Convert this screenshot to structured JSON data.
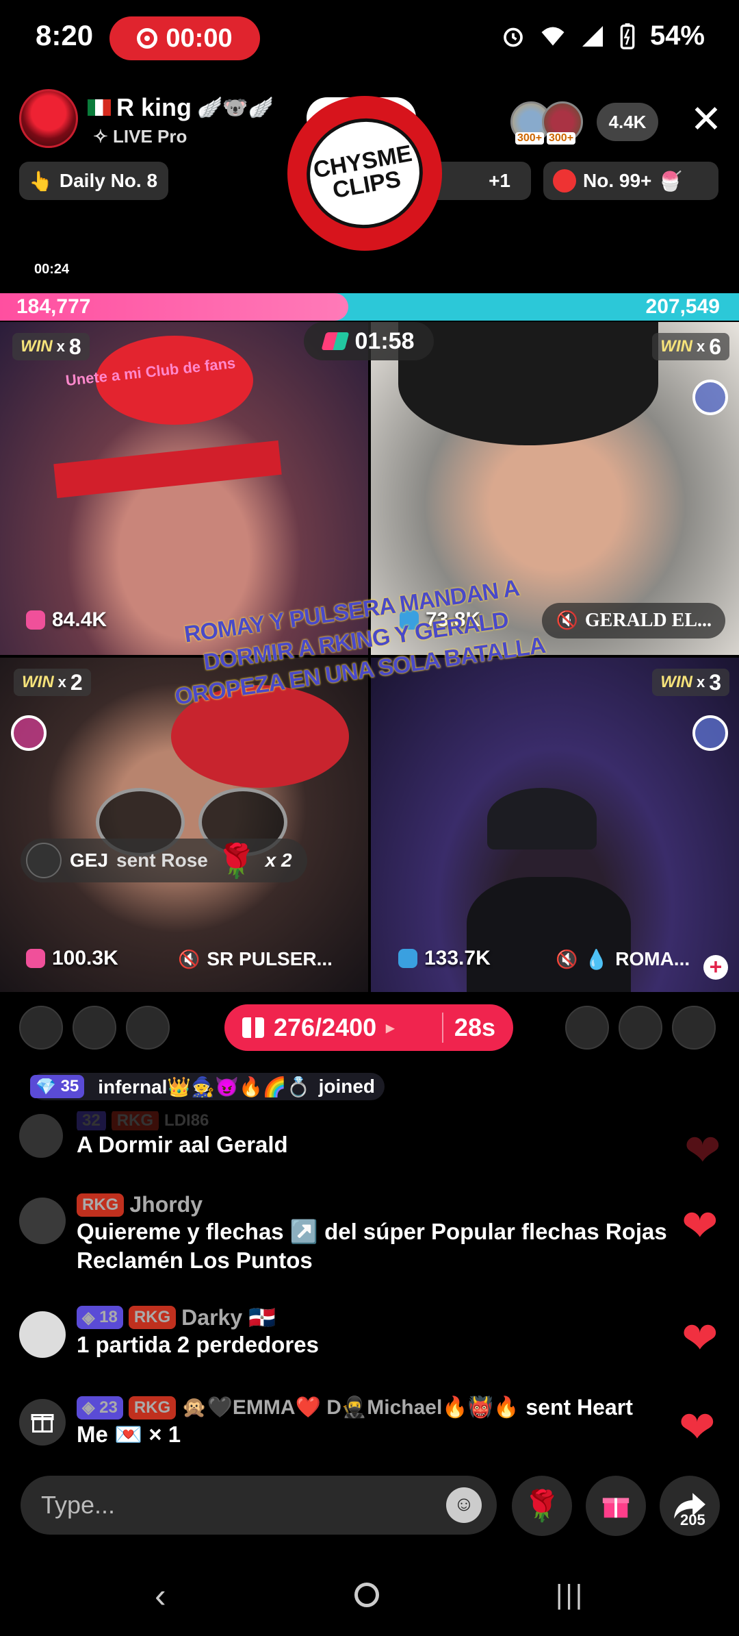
{
  "status": {
    "time": "8:20",
    "recording": "00:00",
    "battery": "54%"
  },
  "host": {
    "name": "R king",
    "badges": "🪽🐨🪽",
    "subtitle": "✧ LIVE Pro",
    "viewer_count": "4.4K",
    "viewer_badge": "300+"
  },
  "pills": {
    "daily": "Daily No. 8",
    "plus": "+1",
    "rank": "No. 99+"
  },
  "logo": {
    "line1": "CHYSME",
    "line2": "CLIPS"
  },
  "timer_small": "00:24",
  "battle": {
    "score_left": "184,777",
    "score_right": "207,549",
    "score_left_share": 0.471,
    "countdown": "01:58"
  },
  "tiles": [
    {
      "win_label": "WIN",
      "win_x": "x",
      "wins": "8",
      "points": "84.4K",
      "banner": "Unete a mi Club de fans"
    },
    {
      "win_label": "WIN",
      "win_x": "x",
      "wins": "6",
      "points": "73.8K",
      "name": "GERALD EL..."
    },
    {
      "win_label": "WIN",
      "win_x": "x",
      "wins": "2",
      "points": "100.3K",
      "name": "SR PULSER..."
    },
    {
      "win_label": "WIN",
      "win_x": "x",
      "wins": "3",
      "points": "133.7K",
      "name": "ROMA..."
    }
  ],
  "overlay_caption": "ROMAY Y PULSERA MANDAN A DORMIR A RKING Y GERALD OROPEZA EN UNA SOLA BATALLA",
  "gift_notice": {
    "user": "GEJ",
    "text": "sent Rose",
    "count": "x 2"
  },
  "gift_goal": {
    "progress": "276/2400",
    "time": "28s"
  },
  "chat": {
    "joined": {
      "level": "35",
      "name": "infernal👑🧙😈🔥🌈💍",
      "text": "joined"
    },
    "messages": [
      {
        "level": "32",
        "fan": "RKG",
        "user": "LDI86",
        "text": "A Dormir aal Gerald"
      },
      {
        "fan": "RKG",
        "user": "Jhordy",
        "text": "Quiereme y flechas ↗️ del súper Popular flechas Rojas Reclamén Los Puntos"
      },
      {
        "level": "18",
        "fan": "RKG",
        "user": "Darky 🇩🇴",
        "text": "1 partida 2 perdedores"
      },
      {
        "level": "23",
        "fan": "RKG",
        "user": "🙊🖤EMMA❤️ D🥷Michael🔥👹🔥",
        "action": "sent Heart",
        "text": "Me 💌 × 1"
      }
    ]
  },
  "input": {
    "placeholder": "Type...",
    "share_count": "205"
  },
  "colors": {
    "accent": "#f0244e",
    "score_left": "#ff4fa0",
    "score_right": "#2cc8d8"
  }
}
